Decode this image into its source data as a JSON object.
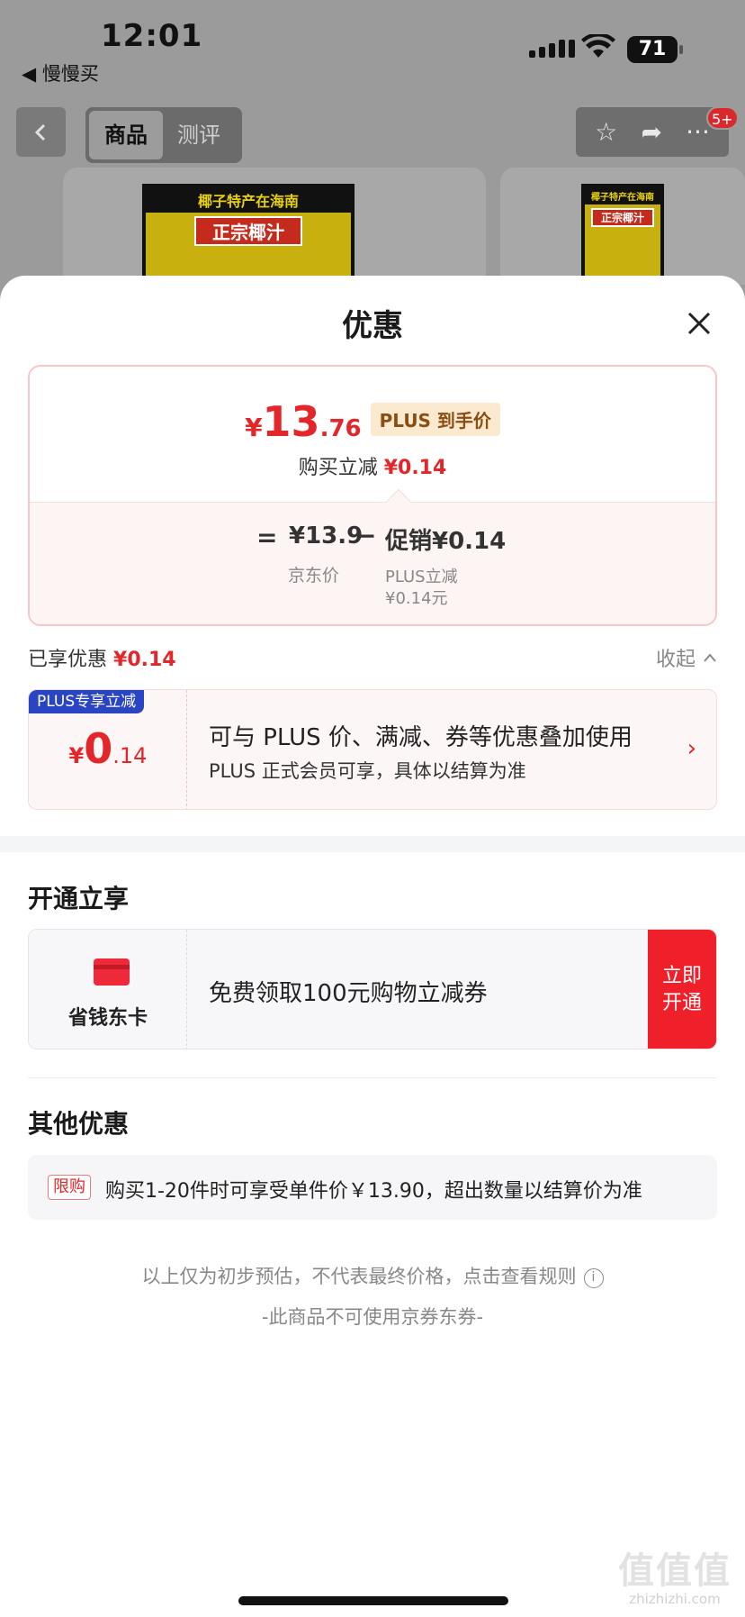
{
  "status_bar": {
    "time": "12:01",
    "back_app": "◀ 慢慢买",
    "battery": "71"
  },
  "nav": {
    "tabs": [
      "商品",
      "测评"
    ],
    "badge": "5+"
  },
  "product_bg": {
    "card1_top": "椰子特产在海南",
    "card1_brand": "正宗椰汁",
    "card2_top": "椰子特产在海南",
    "card2_brand": "正宗椰汁"
  },
  "sheet": {
    "title": "优惠",
    "price": {
      "yen": "¥",
      "integer": "13",
      "decimal": ".76",
      "plus_tag": "PLUS 到手价",
      "sub_label": "购买立减",
      "sub_value": "¥0.14"
    },
    "formula": {
      "eq": "=",
      "base": "¥13.9",
      "minus": "−",
      "promo": "促销¥0.14",
      "base_label": "京东价",
      "promo_label_1": "PLUS立减",
      "promo_label_2": "¥0.14元"
    },
    "enjoyed": {
      "label": "已享优惠",
      "value": "¥0.14",
      "collapse": "收起"
    },
    "coupon": {
      "badge": "PLUS专享立减",
      "yen": "¥",
      "integer": "0",
      "decimal": ".14",
      "line1": "可与 PLUS 价、满减、券等优惠叠加使用",
      "line2": "PLUS 正式会员可享，具体以结算为准"
    },
    "open_section": {
      "title": "开通立享",
      "card_name": "省钱东卡",
      "text": "免费领取100元购物立减券",
      "button_line1": "立即",
      "button_line2": "开通"
    },
    "other_section": {
      "title": "其他优惠",
      "tag": "限购",
      "text": "购买1-20件时可享受单件价￥13.90，超出数量以结算价为准"
    },
    "footer": {
      "note": "以上仅为初步预估，不代表最终价格，点击查看规则",
      "info_icon": "i",
      "no_coupon": "-此商品不可使用京券东券-"
    }
  },
  "watermark": {
    "main": "值值值",
    "sub": "zhizhizhi.com"
  },
  "colors": {
    "accent_red": "#e3262a",
    "plus_blue": "#2a45c4",
    "button_red": "#f0202a"
  }
}
